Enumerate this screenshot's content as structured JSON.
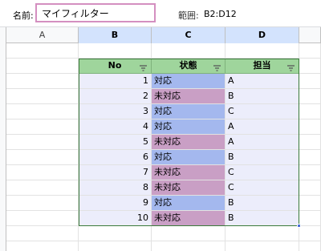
{
  "namebox": {
    "label": "名前:",
    "value": "マイフィルター"
  },
  "range": {
    "label": "範囲:",
    "value": "B2:D12"
  },
  "columns": [
    "A",
    "B",
    "C",
    "D"
  ],
  "table": {
    "headers": [
      "No",
      "状態",
      "担当"
    ],
    "rows": [
      {
        "no": "1",
        "status": "対応",
        "owner": "A"
      },
      {
        "no": "2",
        "status": "未対応",
        "owner": "B"
      },
      {
        "no": "3",
        "status": "対応",
        "owner": "C"
      },
      {
        "no": "4",
        "status": "対応",
        "owner": "A"
      },
      {
        "no": "5",
        "status": "未対応",
        "owner": "A"
      },
      {
        "no": "6",
        "status": "対応",
        "owner": "B"
      },
      {
        "no": "7",
        "status": "未対応",
        "owner": "C"
      },
      {
        "no": "8",
        "status": "未対応",
        "owner": "C"
      },
      {
        "no": "9",
        "status": "対応",
        "owner": "B"
      },
      {
        "no": "10",
        "status": "未対応",
        "owner": "B"
      }
    ]
  },
  "colors": {
    "header_green": "#9fd59c",
    "status_done": "#a4b8ee",
    "status_pending": "#c99fc5",
    "row_bg": "#ecedfb",
    "filter_box_border": "#d48fc0"
  }
}
